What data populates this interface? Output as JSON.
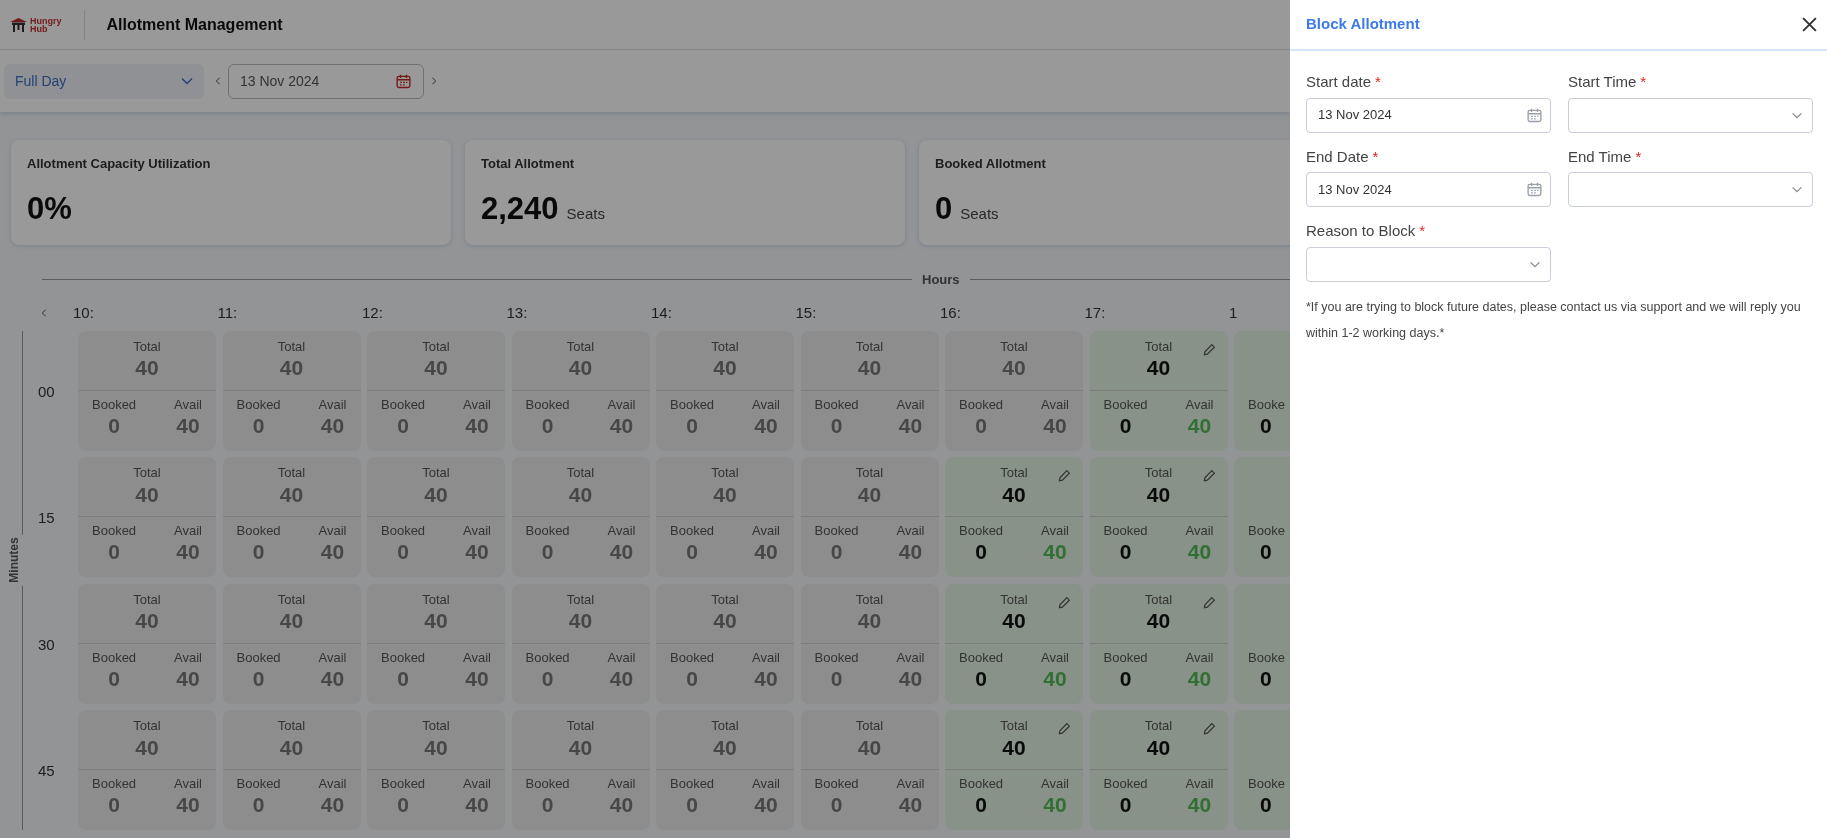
{
  "header": {
    "logo_lines": [
      "Hungry",
      "Hub"
    ],
    "title": "Allotment Management"
  },
  "filters": {
    "period": "Full Day",
    "date": "13 Nov 2024"
  },
  "stats": [
    {
      "label": "Allotment Capacity Utilization",
      "value": "0%"
    },
    {
      "label": "Total Allotment",
      "value": "2,240",
      "unit": "Seats"
    },
    {
      "label": "Booked Allotment",
      "value": "0",
      "unit": "Seats"
    }
  ],
  "grid": {
    "hours_label": "Hours",
    "minutes_label": "Minutes",
    "hours": [
      "10:",
      "11:",
      "12:",
      "13:",
      "14:",
      "15:",
      "16:",
      "17:",
      "1"
    ],
    "rows": [
      {
        "minute": "00",
        "cells": [
          {
            "kind": "full",
            "open": false,
            "total_label": "Total",
            "total": "40",
            "booked_label": "Booked",
            "booked": "0",
            "avail_label": "Avail",
            "avail": "40"
          },
          {
            "kind": "full",
            "open": false,
            "total_label": "Total",
            "total": "40",
            "booked_label": "Booked",
            "booked": "0",
            "avail_label": "Avail",
            "avail": "40"
          },
          {
            "kind": "full",
            "open": false,
            "total_label": "Total",
            "total": "40",
            "booked_label": "Booked",
            "booked": "0",
            "avail_label": "Avail",
            "avail": "40"
          },
          {
            "kind": "full",
            "open": false,
            "total_label": "Total",
            "total": "40",
            "booked_label": "Booked",
            "booked": "0",
            "avail_label": "Avail",
            "avail": "40"
          },
          {
            "kind": "full",
            "open": false,
            "total_label": "Total",
            "total": "40",
            "booked_label": "Booked",
            "booked": "0",
            "avail_label": "Avail",
            "avail": "40"
          },
          {
            "kind": "full",
            "open": false,
            "total_label": "Total",
            "total": "40",
            "booked_label": "Booked",
            "booked": "0",
            "avail_label": "Avail",
            "avail": "40"
          },
          {
            "kind": "full",
            "open": false,
            "total_label": "Total",
            "total": "40",
            "booked_label": "Booked",
            "booked": "0",
            "avail_label": "Avail",
            "avail": "40"
          },
          {
            "kind": "full",
            "open": true,
            "total_label": "Total",
            "total": "40",
            "booked_label": "Booked",
            "booked": "0",
            "avail_label": "Avail",
            "avail": "40"
          },
          {
            "kind": "partial",
            "open": true,
            "booked_label": "Booke",
            "booked": "0"
          }
        ]
      },
      {
        "minute": "15",
        "cells": [
          {
            "kind": "full",
            "open": false,
            "total_label": "Total",
            "total": "40",
            "booked_label": "Booked",
            "booked": "0",
            "avail_label": "Avail",
            "avail": "40"
          },
          {
            "kind": "full",
            "open": false,
            "total_label": "Total",
            "total": "40",
            "booked_label": "Booked",
            "booked": "0",
            "avail_label": "Avail",
            "avail": "40"
          },
          {
            "kind": "full",
            "open": false,
            "total_label": "Total",
            "total": "40",
            "booked_label": "Booked",
            "booked": "0",
            "avail_label": "Avail",
            "avail": "40"
          },
          {
            "kind": "full",
            "open": false,
            "total_label": "Total",
            "total": "40",
            "booked_label": "Booked",
            "booked": "0",
            "avail_label": "Avail",
            "avail": "40"
          },
          {
            "kind": "full",
            "open": false,
            "total_label": "Total",
            "total": "40",
            "booked_label": "Booked",
            "booked": "0",
            "avail_label": "Avail",
            "avail": "40"
          },
          {
            "kind": "full",
            "open": false,
            "total_label": "Total",
            "total": "40",
            "booked_label": "Booked",
            "booked": "0",
            "avail_label": "Avail",
            "avail": "40"
          },
          {
            "kind": "full",
            "open": true,
            "total_label": "Total",
            "total": "40",
            "booked_label": "Booked",
            "booked": "0",
            "avail_label": "Avail",
            "avail": "40"
          },
          {
            "kind": "full",
            "open": true,
            "total_label": "Total",
            "total": "40",
            "booked_label": "Booked",
            "booked": "0",
            "avail_label": "Avail",
            "avail": "40"
          },
          {
            "kind": "partial",
            "open": true,
            "booked_label": "Booke",
            "booked": "0"
          }
        ]
      },
      {
        "minute": "30",
        "cells": [
          {
            "kind": "full",
            "open": false,
            "total_label": "Total",
            "total": "40",
            "booked_label": "Booked",
            "booked": "0",
            "avail_label": "Avail",
            "avail": "40"
          },
          {
            "kind": "full",
            "open": false,
            "total_label": "Total",
            "total": "40",
            "booked_label": "Booked",
            "booked": "0",
            "avail_label": "Avail",
            "avail": "40"
          },
          {
            "kind": "full",
            "open": false,
            "total_label": "Total",
            "total": "40",
            "booked_label": "Booked",
            "booked": "0",
            "avail_label": "Avail",
            "avail": "40"
          },
          {
            "kind": "full",
            "open": false,
            "total_label": "Total",
            "total": "40",
            "booked_label": "Booked",
            "booked": "0",
            "avail_label": "Avail",
            "avail": "40"
          },
          {
            "kind": "full",
            "open": false,
            "total_label": "Total",
            "total": "40",
            "booked_label": "Booked",
            "booked": "0",
            "avail_label": "Avail",
            "avail": "40"
          },
          {
            "kind": "full",
            "open": false,
            "total_label": "Total",
            "total": "40",
            "booked_label": "Booked",
            "booked": "0",
            "avail_label": "Avail",
            "avail": "40"
          },
          {
            "kind": "full",
            "open": true,
            "total_label": "Total",
            "total": "40",
            "booked_label": "Booked",
            "booked": "0",
            "avail_label": "Avail",
            "avail": "40"
          },
          {
            "kind": "full",
            "open": true,
            "total_label": "Total",
            "total": "40",
            "booked_label": "Booked",
            "booked": "0",
            "avail_label": "Avail",
            "avail": "40"
          },
          {
            "kind": "partial",
            "open": true,
            "booked_label": "Booke",
            "booked": "0"
          }
        ]
      },
      {
        "minute": "45",
        "cells": [
          {
            "kind": "full",
            "open": false,
            "total_label": "Total",
            "total": "40",
            "booked_label": "Booked",
            "booked": "0",
            "avail_label": "Avail",
            "avail": "40"
          },
          {
            "kind": "full",
            "open": false,
            "total_label": "Total",
            "total": "40",
            "booked_label": "Booked",
            "booked": "0",
            "avail_label": "Avail",
            "avail": "40"
          },
          {
            "kind": "full",
            "open": false,
            "total_label": "Total",
            "total": "40",
            "booked_label": "Booked",
            "booked": "0",
            "avail_label": "Avail",
            "avail": "40"
          },
          {
            "kind": "full",
            "open": false,
            "total_label": "Total",
            "total": "40",
            "booked_label": "Booked",
            "booked": "0",
            "avail_label": "Avail",
            "avail": "40"
          },
          {
            "kind": "full",
            "open": false,
            "total_label": "Total",
            "total": "40",
            "booked_label": "Booked",
            "booked": "0",
            "avail_label": "Avail",
            "avail": "40"
          },
          {
            "kind": "full",
            "open": false,
            "total_label": "Total",
            "total": "40",
            "booked_label": "Booked",
            "booked": "0",
            "avail_label": "Avail",
            "avail": "40"
          },
          {
            "kind": "full",
            "open": true,
            "total_label": "Total",
            "total": "40",
            "booked_label": "Booked",
            "booked": "0",
            "avail_label": "Avail",
            "avail": "40"
          },
          {
            "kind": "full",
            "open": true,
            "total_label": "Total",
            "total": "40",
            "booked_label": "Booked",
            "booked": "0",
            "avail_label": "Avail",
            "avail": "40"
          },
          {
            "kind": "partial",
            "open": true,
            "booked_label": "Booke",
            "booked": "0"
          }
        ]
      }
    ]
  },
  "drawer": {
    "title": "Block Allotment",
    "required_mark": "*",
    "fields": [
      {
        "kind": "date",
        "label": "Start date",
        "required": true,
        "value": "13 Nov 2024"
      },
      {
        "kind": "select",
        "label": "Start Time",
        "required": true
      },
      {
        "kind": "date",
        "label": "End Date",
        "required": true,
        "value": "13 Nov 2024"
      },
      {
        "kind": "select",
        "label": "End Time",
        "required": true
      },
      {
        "kind": "select",
        "label": "Reason to Block",
        "required": true
      }
    ],
    "note": "*If you are trying to block future dates, please contact us via support and we will reply you within 1-2 working days.*"
  }
}
